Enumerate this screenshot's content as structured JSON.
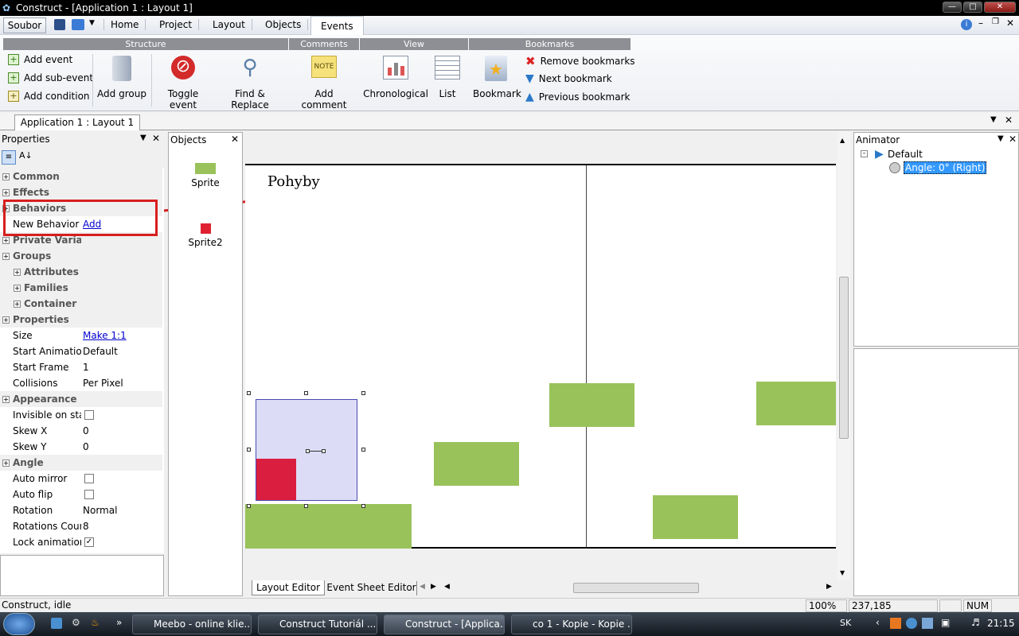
{
  "window": {
    "title": "Construct - [Application 1 : Layout 1]"
  },
  "menubar": {
    "soubor": "Soubor",
    "tabs": [
      "Home",
      "Project",
      "Layout",
      "Objects",
      "Events"
    ]
  },
  "ribbon": {
    "groups": [
      "Structure",
      "Comments",
      "View",
      "Bookmarks"
    ],
    "add_event": "Add event",
    "add_sub_event": "Add sub-event",
    "add_condition": "Add condition",
    "add_group": "Add group",
    "toggle_event": "Toggle event",
    "find_replace": "Find & Replace",
    "add_comment": "Add comment",
    "note_icon_text": "NOTE",
    "chronological": "Chronological",
    "list": "List",
    "bookmark": "Bookmark",
    "remove_bookmarks": "Remove bookmarks",
    "next_bookmark": "Next bookmark",
    "previous_bookmark": "Previous bookmark"
  },
  "doc_tab": "Application 1 : Layout 1",
  "properties": {
    "title": "Properties",
    "rows": [
      {
        "type": "cat",
        "label": "Common"
      },
      {
        "type": "cat",
        "label": "Effects"
      },
      {
        "type": "cat",
        "label": "Behaviors"
      },
      {
        "type": "prop",
        "label": "New Behavior",
        "value": "Add",
        "link": true
      },
      {
        "type": "cat",
        "label": "Private Variables"
      },
      {
        "type": "cat",
        "label": "Groups"
      },
      {
        "type": "sub",
        "label": "Attributes"
      },
      {
        "type": "sub",
        "label": "Families"
      },
      {
        "type": "sub",
        "label": "Container"
      },
      {
        "type": "cat",
        "label": "Properties"
      },
      {
        "type": "prop",
        "label": "Size",
        "value": "Make 1:1",
        "link": true
      },
      {
        "type": "prop",
        "label": "Start Animation",
        "value": "Default"
      },
      {
        "type": "prop",
        "label": "Start Frame",
        "value": "1"
      },
      {
        "type": "prop",
        "label": "Collisions",
        "value": "Per Pixel"
      },
      {
        "type": "cat",
        "label": "Appearance"
      },
      {
        "type": "check",
        "label": "Invisible on start",
        "checked": false
      },
      {
        "type": "prop",
        "label": "Skew X",
        "value": "0"
      },
      {
        "type": "prop",
        "label": "Skew Y",
        "value": "0"
      },
      {
        "type": "cat",
        "label": "Angle"
      },
      {
        "type": "check",
        "label": "Auto mirror",
        "checked": false
      },
      {
        "type": "check",
        "label": "Auto flip",
        "checked": false
      },
      {
        "type": "prop",
        "label": "Rotation",
        "value": "Normal"
      },
      {
        "type": "prop",
        "label": "Rotations Count",
        "value": "8"
      },
      {
        "type": "check",
        "label": "Lock animation",
        "checked": true
      }
    ]
  },
  "objects": {
    "title": "Objects",
    "items": [
      {
        "name": "Sprite",
        "color": "#99c25a"
      },
      {
        "name": "Sprite2",
        "color": "#e02030"
      }
    ]
  },
  "annotation": {
    "text": "Pohyby",
    "color": "#d81e1e"
  },
  "editor_tabs": {
    "layout": "Layout Editor",
    "event": "Event Sheet Editor"
  },
  "animator": {
    "title": "Animator",
    "root": "Default",
    "child": "Angle: 0° (Right)"
  },
  "status": {
    "text": "Construct, idle",
    "zoom": "100%",
    "coords": "237,185",
    "num": "NUM"
  },
  "taskbar": {
    "tasks": [
      "Meebo - online klie...",
      "Construct Tutoriál ...",
      "Construct - [Applica...",
      "co 1 - Kopie - Kopie ..."
    ],
    "lang": "SK",
    "clock": "21:15"
  }
}
